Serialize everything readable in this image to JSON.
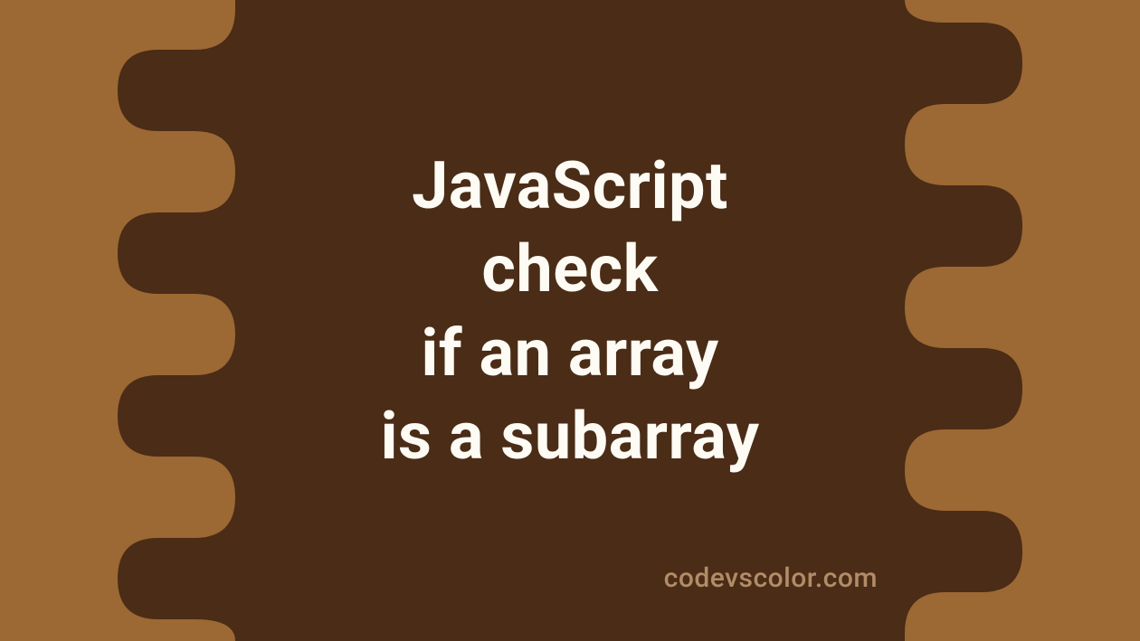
{
  "title_lines": [
    "JavaScript",
    "check",
    "if an array",
    "is a subarray"
  ],
  "watermark": "codevscolor.com",
  "colors": {
    "background": "#9c6833",
    "blob": "#4a2c17",
    "text": "#fdfbf4",
    "watermark": "#b28c67"
  }
}
